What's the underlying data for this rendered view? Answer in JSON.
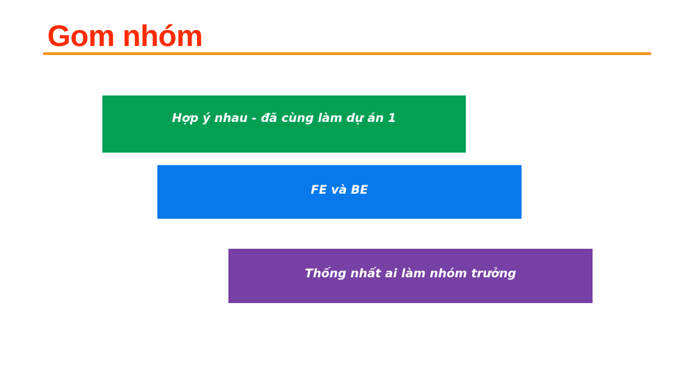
{
  "slide": {
    "title": "Gom nhóm",
    "colors": {
      "title": "#ff2a00",
      "rule": "#f7961e"
    },
    "items": [
      {
        "label": "Hợp ý nhau - đã cùng làm dự án 1",
        "color": "#03a054"
      },
      {
        "label": "FE và BE",
        "color": "#0879ea"
      },
      {
        "label": "Thống nhất ai làm nhóm trưởng",
        "color": "#7640a4"
      }
    ]
  }
}
